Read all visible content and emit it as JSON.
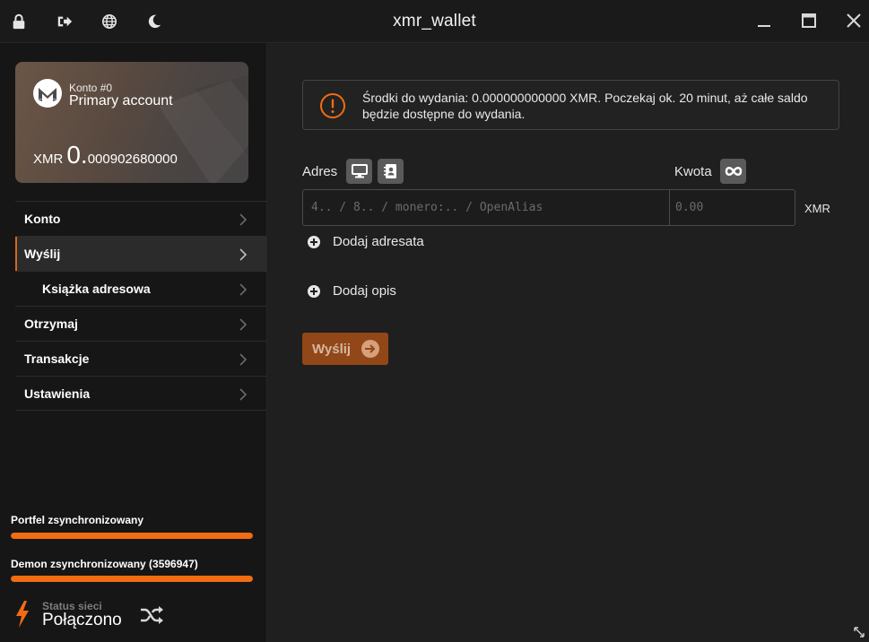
{
  "titlebar": {
    "title": "xmr_wallet",
    "icons": [
      "lock-icon",
      "sign-out-icon",
      "globe-icon",
      "moon-icon"
    ],
    "window_controls": [
      "minimize-icon",
      "maximize-icon",
      "close-icon"
    ]
  },
  "account": {
    "number_label": "Konto #0",
    "name": "Primary account",
    "currency": "XMR",
    "balance_int": "0.",
    "balance_dec": "000902680000"
  },
  "sidebar": {
    "items": [
      {
        "label": "Konto",
        "active": false,
        "sub": false
      },
      {
        "label": "Wyślij",
        "active": true,
        "sub": false
      },
      {
        "label": "Książka adresowa",
        "active": false,
        "sub": true
      },
      {
        "label": "Otrzymaj",
        "active": false,
        "sub": false
      },
      {
        "label": "Transakcje",
        "active": false,
        "sub": false
      },
      {
        "label": "Ustawienia",
        "active": false,
        "sub": false
      }
    ],
    "wallet_sync_label": "Portfel zsynchronizowany",
    "wallet_sync_progress": 1.0,
    "daemon_sync_label": "Demon zsynchronizowany (3596947)",
    "daemon_sync_progress": 1.0,
    "network_status_label": "Status sieci",
    "network_status_value": "Połączono"
  },
  "main": {
    "alert_text": "Środki do wydania: 0.000000000000 XMR. Poczekaj ok. 20 minut, aż całe saldo będzie dostępne do wydania.",
    "address_label": "Adres",
    "amount_label": "Kwota",
    "address_placeholder": "4.. / 8.. / monero:.. / OpenAlias",
    "amount_placeholder": "0.00",
    "amount_currency": "XMR",
    "add_recipient": "Dodaj adresata",
    "add_description": "Dodaj opis",
    "send_button": "Wyślij"
  },
  "colors": {
    "accent": "#f26c12",
    "send_button_bg": "#914718",
    "background": "#1f1f1f",
    "sidebar_bg": "#161616"
  }
}
